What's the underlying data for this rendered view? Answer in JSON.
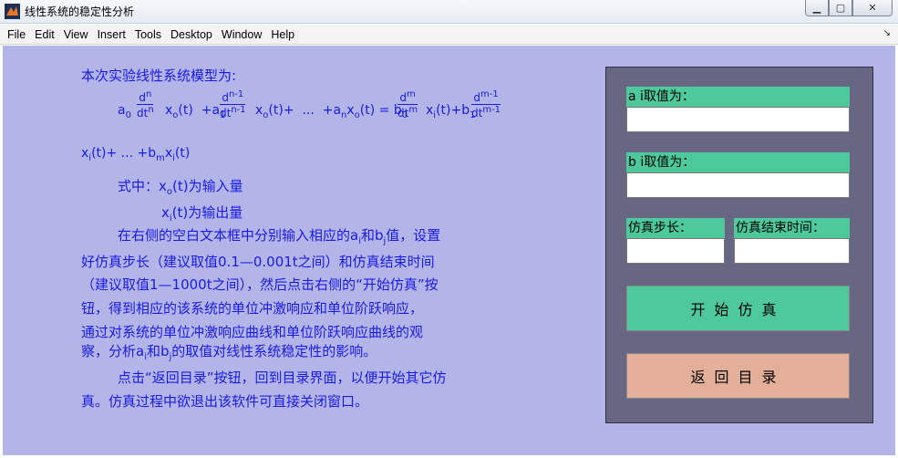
{
  "window": {
    "title": "线性系统的稳定性分析"
  },
  "menu": [
    "File",
    "Edit",
    "View",
    "Insert",
    "Tools",
    "Desktop",
    "Window",
    "Help"
  ],
  "content": {
    "line_model": "本次实验线性系统模型为:",
    "formula_tail": "x_i(t)+ ... +b_m x_i(t)",
    "where1": "式中：x_o(t)为输入量",
    "where2": "x_i(t)为输出量",
    "para1_l1": "在右侧的空白文本框中分别输入相应的a_i和b_j值，设置",
    "para1_l2": "好仿真步长（建议取值0.1—0.001t之间）和仿真结束时间",
    "para1_l3": "（建议取值1—1000t之间），然后点击右侧的“开始仿真”按",
    "para1_l4": "钮，得到相应的该系统的单位冲激响应和单位阶跃响应，",
    "para1_l5": "通过对系统的单位冲激响应曲线和单位阶跃响应曲线的观",
    "para1_l6": "察，分析a_i和b_j的取值对线性系统稳定性的影响。",
    "para2_l1": "点击“返回目录”按钮，回到目录界面，以便开始其它仿",
    "para2_l2": "真。仿真过程中欲退出该软件可直接关闭窗口。"
  },
  "panel": {
    "a_label": "a i取值为：",
    "a_value": "",
    "b_label": "b i取值为：",
    "b_value": "",
    "step_label": "仿真步长：",
    "step_value": "",
    "end_label": "仿真结束时间：",
    "end_value": "",
    "start_button": "开始仿真",
    "back_button": "返回目录"
  },
  "colors": {
    "canvas": "#b3b5e8",
    "text": "#1a1ae6",
    "panel": "#686783",
    "green": "#4dc99b",
    "salmon": "#e3af98"
  }
}
